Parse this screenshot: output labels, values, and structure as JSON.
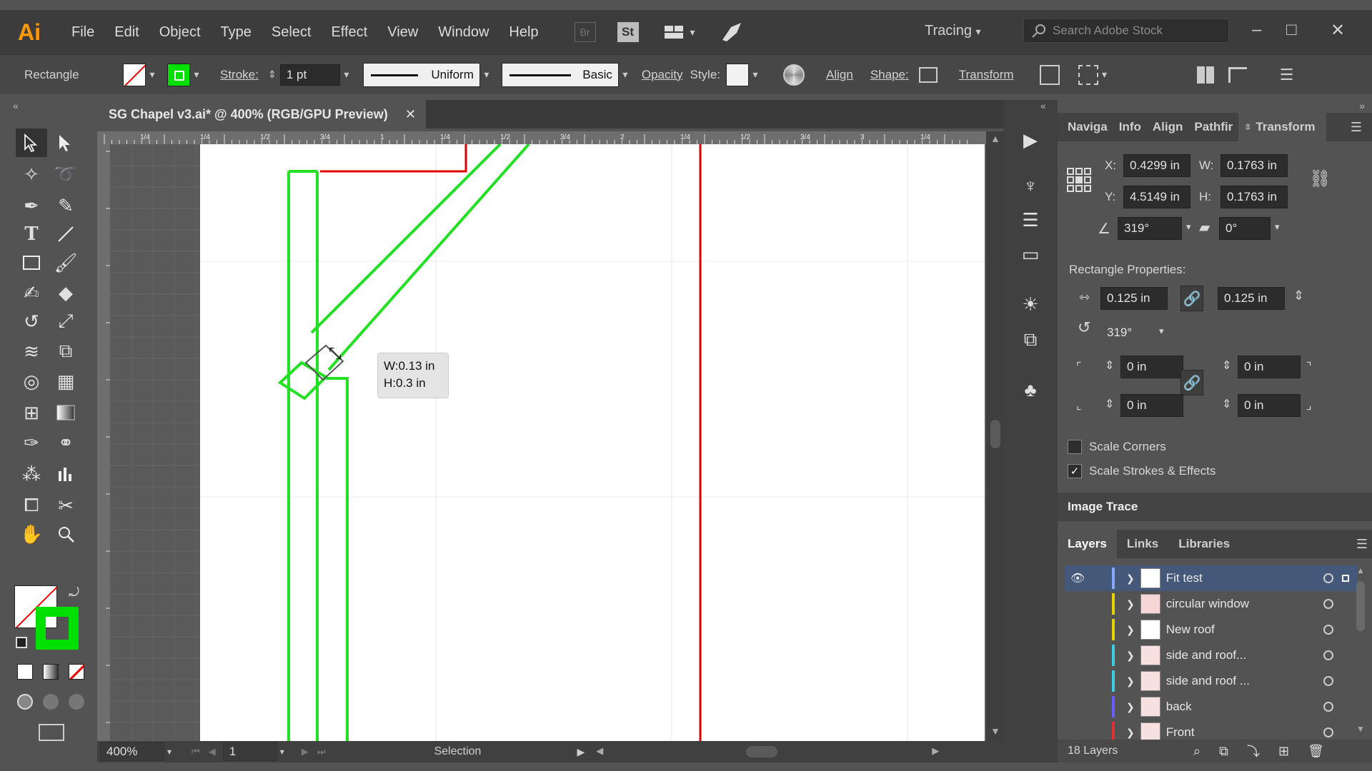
{
  "app": {
    "logo": "Ai",
    "menu": [
      "File",
      "Edit",
      "Object",
      "Type",
      "Select",
      "Effect",
      "View",
      "Window",
      "Help"
    ],
    "bridge": "Br",
    "stock": "St",
    "workspace": "Tracing",
    "search_placeholder": "Search Adobe Stock",
    "window_controls": [
      "–",
      "□",
      "✕"
    ]
  },
  "control_bar": {
    "selection": "Rectangle",
    "stroke_label": "Stroke:",
    "stroke_value": "1 pt",
    "profile": "Uniform",
    "brush": "Basic",
    "opacity_label": "Opacity",
    "style_label": "Style:",
    "align_label": "Align",
    "shape_label": "Shape:",
    "transform_label": "Transform",
    "stroke_color": "#00e000"
  },
  "document": {
    "tab_title": "SG Chapel v3.ai* @ 400% (RGB/GPU Preview)",
    "close": "✕",
    "ruler_labels": [
      "1/4",
      "1/4",
      "1/2",
      "3/4",
      "1",
      "1/4",
      "1/2",
      "3/4",
      "2",
      "1/4",
      "1/2",
      "3/4",
      "3",
      "1/4"
    ],
    "tooltip_w": "W:0.13 in",
    "tooltip_h": "H:0.3 in"
  },
  "status": {
    "zoom": "400%",
    "page": "1",
    "tool": "Selection"
  },
  "transform_panel": {
    "tabs": [
      "Naviga",
      "Info",
      "Align",
      "Pathfir",
      "Transform"
    ],
    "x_label": "X:",
    "x": "0.4299 in",
    "y_label": "Y:",
    "y": "4.5149 in",
    "w_label": "W:",
    "w": "0.1763 in",
    "h_label": "H:",
    "h": "0.1763 in",
    "angle": "319°",
    "shear": "0°",
    "rect_props_label": "Rectangle Properties:",
    "rect_w": "0.125 in",
    "rect_h": "0.125 in",
    "rect_angle": "319°",
    "corner_tl": "0 in",
    "corner_tr": "0 in",
    "corner_bl": "0 in",
    "corner_br": "0 in",
    "scale_corners": "Scale Corners",
    "scale_strokes": "Scale Strokes & Effects"
  },
  "image_trace": {
    "title": "Image Trace"
  },
  "layers_panel": {
    "tabs": [
      "Layers",
      "Links",
      "Libraries"
    ],
    "layers": [
      {
        "name": "Fit test",
        "color": "#8aa6ff"
      },
      {
        "name": "circular window",
        "color": "#e8d000"
      },
      {
        "name": "New roof",
        "color": "#e8d000"
      },
      {
        "name": "side and roof...",
        "color": "#37d0e0"
      },
      {
        "name": "side and roof ...",
        "color": "#37d0e0"
      },
      {
        "name": "back",
        "color": "#6a5cff"
      },
      {
        "name": "Front",
        "color": "#e03030"
      }
    ],
    "count": "18 Layers"
  }
}
